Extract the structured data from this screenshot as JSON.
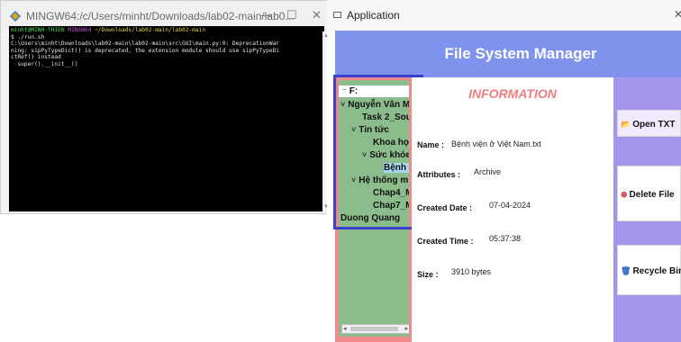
{
  "terminal": {
    "title": "MINGW64:/c/Users/minht/Downloads/lab02-main/lab0...",
    "prompt_user": "minht@MINH-THIEN",
    "prompt_shell": "MINGW64",
    "prompt_path": "~/Downloads/lab02-main/lab02-main",
    "lines": [
      "$ ./run.sh",
      "C:\\Users\\minht\\Downloads\\lab02-main\\lab02-main\\src\\GUI\\main.py:9: DeprecationWar",
      "ning: sipPyTypeDict() is deprecated, the extension module should use sipPyTypeDi",
      "ctRef() instead",
      "  super().__init__()"
    ],
    "controls": {
      "minimize": "—",
      "maximize": "☐",
      "close": "✕"
    }
  },
  "app": {
    "window_title": "Application",
    "close_glyph": "✕",
    "heading": "File System Manager",
    "tree": {
      "root": "F:",
      "items": [
        {
          "caret": "˅",
          "label": "Nguyễn Văn M"
        },
        {
          "caret": "",
          "label": "Task 2_Sour"
        },
        {
          "caret": "˅",
          "label": "Tin tức"
        },
        {
          "caret": "",
          "label": "Khoa học"
        },
        {
          "caret": "˅",
          "label": "Sức khỏe"
        },
        {
          "caret": "",
          "label": "Bệnh v"
        },
        {
          "caret": "˅",
          "label": "Hệ thống m"
        },
        {
          "caret": "",
          "label": "Chap4_M"
        },
        {
          "caret": "",
          "label": "Chap7_M"
        },
        {
          "caret": "",
          "label": "Duong Quang"
        }
      ]
    },
    "info": {
      "title": "INFORMATION",
      "name_label": "Name :",
      "name_value": "Bệnh viện ở Việt Nam.txt",
      "attributes_label": "Attributes :",
      "attributes_value": "Archive",
      "created_date_label": "Created Date :",
      "created_date_value": "07-04-2024",
      "created_time_label": "Created Time :",
      "created_time_value": "05:37:38",
      "size_label": "Size :",
      "size_value": "3910 bytes"
    },
    "buttons": {
      "open_txt": "Open TXT",
      "delete_file": "Delete File",
      "recycle_bin": "Recycle Bin"
    },
    "colors": {
      "header": "#7f92ec",
      "tree_panel_border": "#f08a8a",
      "tree_background": "#8bbc8c",
      "side_panel": "#a695ec",
      "info_title": "#ef7d7d",
      "focus_outline": "#3a3fcc"
    }
  }
}
